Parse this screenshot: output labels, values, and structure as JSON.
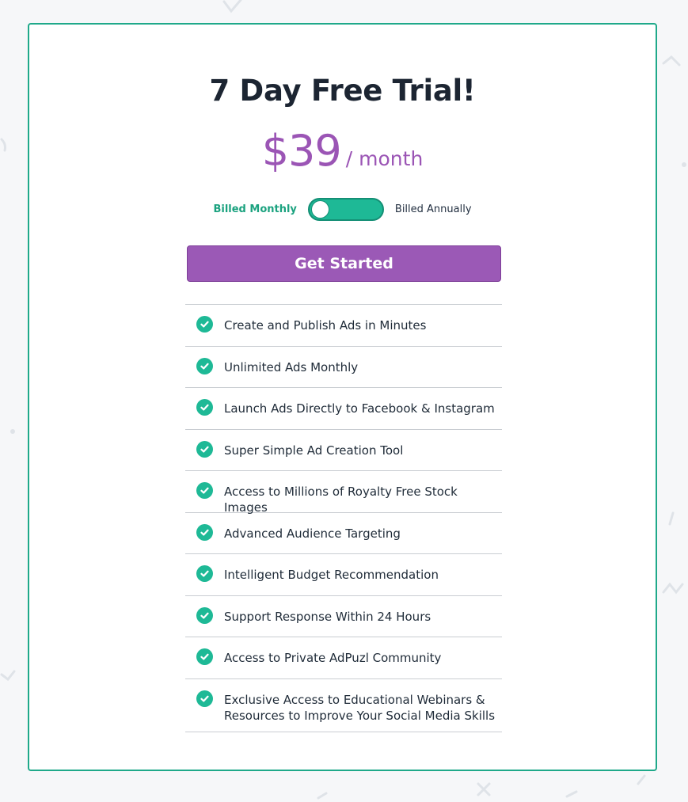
{
  "plan": {
    "title": "7 Day Free Trial!",
    "price": "$39",
    "period": "/ month"
  },
  "billing": {
    "monthly_label": "Billed Monthly",
    "annual_label": "Billed Annually",
    "selected": "monthly"
  },
  "cta": {
    "label": "Get Started"
  },
  "features": [
    "Create and Publish Ads in Minutes",
    "Unlimited Ads Monthly",
    "Launch Ads Directly to Facebook & Instagram",
    "Super Simple Ad Creation Tool",
    "Access to Millions of Royalty Free Stock Images",
    "Advanced Audience Targeting",
    "Intelligent Budget Recommendation",
    "Support Response Within 24 Hours",
    "Access to Private AdPuzl Community",
    "Exclusive Access to Educational Webinars & Resources to Improve Your Social Media Skills"
  ],
  "icons": {
    "feature_check": "check-circle-icon"
  },
  "colors": {
    "accent_green": "#1eb996",
    "accent_purple": "#9b59b6",
    "card_border": "#1fa98a",
    "title_text": "#1c2532"
  }
}
